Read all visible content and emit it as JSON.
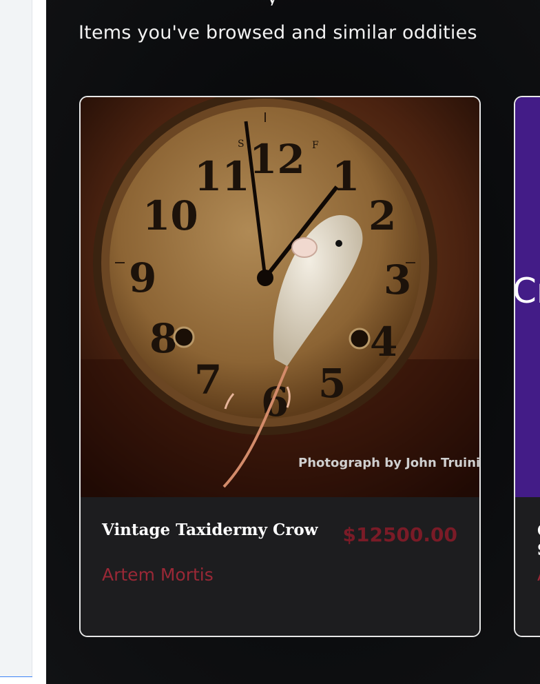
{
  "section": {
    "subtitle": "Items you've browsed and similar oddities"
  },
  "products": [
    {
      "name": "Vintage Taxidermy Crow",
      "price": "$12500.00",
      "seller": "Artem Mortis",
      "image_credit": "Photograph by John Truini",
      "image_icon": "clock-with-mouse-photo"
    },
    {
      "image_text": "Cr",
      "name_fragment_1": "C",
      "name_fragment_2": "S",
      "seller_fragment": "A",
      "image_color": "#431c87"
    }
  ],
  "colors": {
    "price": "#7a1b27",
    "seller": "#9a2836",
    "card_bg": "#1d1d1f"
  }
}
